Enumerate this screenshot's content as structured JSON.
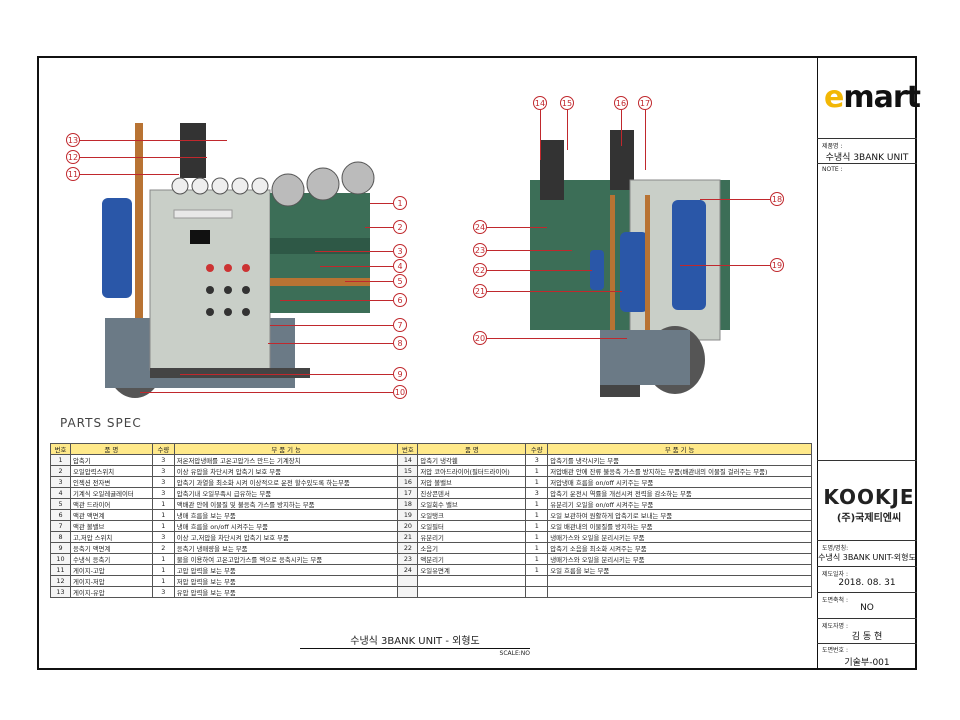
{
  "brand": {
    "logo_e": "e",
    "logo_rest": "mart"
  },
  "title_block": {
    "product_name_label": "제품명 :",
    "product_name": "수냉식 3BANK UNIT",
    "note_label": "NOTE :",
    "company_logo": "KOOKJE",
    "company_name": "(주)국제티엔씨",
    "drawing_name_label": "도명/명칭:",
    "drawing_name": "수냉식 3BANK UNIT-외형도",
    "date_label": "제도일자 :",
    "date": "2018. 08. 31",
    "scale_label": "도면축척 :",
    "scale": "NO",
    "drafter_label": "제도자명 :",
    "drafter": "김 동 현",
    "drawing_no_label": "도면번호 :",
    "drawing_no": "기술부-001"
  },
  "parts_spec_title": "PARTS SPEC",
  "table_headers": {
    "no": "번호",
    "name": "품        명",
    "qty": "수량",
    "function": "부    품    기    능"
  },
  "parts_left": [
    {
      "no": "1",
      "name": "압축기",
      "qty": "3",
      "function": "저온저압냉매를 고온고압가스 만드는 기계장치"
    },
    {
      "no": "2",
      "name": "오일압력스위치",
      "qty": "3",
      "function": "이상 유압을 차단시켜 압축기 보호 부품"
    },
    {
      "no": "3",
      "name": "인젝션 전자변",
      "qty": "3",
      "function": "압축기 과열을 최소화 시켜 이상적으로 운전 할수있도록 하는부품"
    },
    {
      "no": "4",
      "name": "기계식 오일레귤레이터",
      "qty": "3",
      "function": "압축기내 오일부족시 급유하는 부품"
    },
    {
      "no": "5",
      "name": "액관 드라이어",
      "qty": "1",
      "function": "액배관 안에 이물질 및 불응축 가스를 방지하는 부품"
    },
    {
      "no": "6",
      "name": "액관 액면계",
      "qty": "1",
      "function": "냉매 흐름을 보는 부품"
    },
    {
      "no": "7",
      "name": "액관 볼밸브",
      "qty": "1",
      "function": "냉매 흐름을 on/off 시켜주는 부품"
    },
    {
      "no": "8",
      "name": "고,저압 스위치",
      "qty": "3",
      "function": "이상 고,저압을 차단시켜 압축기 보호 부품"
    },
    {
      "no": "9",
      "name": "응축기 액면계",
      "qty": "2",
      "function": "응축기 냉매량을 보는 부품"
    },
    {
      "no": "10",
      "name": "수냉식 응축기",
      "qty": "1",
      "function": "물을 이용하여 고온고압가스를 액으로 응축시키는 부품"
    },
    {
      "no": "11",
      "name": "게이지-고압",
      "qty": "1",
      "function": "고압 압력을 보는 부품"
    },
    {
      "no": "12",
      "name": "게이지-저압",
      "qty": "1",
      "function": "저압 압력을 보는 부품"
    },
    {
      "no": "13",
      "name": "게이지-유압",
      "qty": "3",
      "function": "유압 압력을 보는 부품"
    }
  ],
  "parts_right": [
    {
      "no": "14",
      "name": "압축기 냉각휀",
      "qty": "3",
      "function": "압축기를 냉각시키는 부품"
    },
    {
      "no": "15",
      "name": "저압 코아드라이어(필터드라이어)",
      "qty": "1",
      "function": "저압배관 안에 잔류 불응축 가스를 방지하는 부품(배관내의 이물질 걸러주는 부품)"
    },
    {
      "no": "16",
      "name": "저압 볼밸브",
      "qty": "1",
      "function": "저압냉매 흐름을 on/off 시키주는 부품"
    },
    {
      "no": "17",
      "name": "진상콘덴서",
      "qty": "3",
      "function": "압축기 운전시 역률을 개선시켜 전력을 감소하는 부품"
    },
    {
      "no": "18",
      "name": "오일회수 밸브",
      "qty": "1",
      "function": "유분리기 오일을 on/off 시켜주는 부품"
    },
    {
      "no": "19",
      "name": "오일탱크",
      "qty": "1",
      "function": "오일 보관하여 원활하게 압축기로 보내는 부품"
    },
    {
      "no": "20",
      "name": "오일필터",
      "qty": "1",
      "function": "오일 배관내의 이물질를 방지하는 부품"
    },
    {
      "no": "21",
      "name": "유분리기",
      "qty": "1",
      "function": "냉매가스와 오일을 분리시키는 부품"
    },
    {
      "no": "22",
      "name": "소음기",
      "qty": "1",
      "function": "압축기 소음을 최소화 시켜주는 부품"
    },
    {
      "no": "23",
      "name": "액분리기",
      "qty": "1",
      "function": "냉매가스와 오일을 분리시키는 부품"
    },
    {
      "no": "24",
      "name": "오일유면계",
      "qty": "1",
      "function": "오일 흐름을 보는 부품"
    },
    {
      "no": "",
      "name": "",
      "qty": "",
      "function": ""
    },
    {
      "no": "",
      "name": "",
      "qty": "",
      "function": ""
    }
  ],
  "drawing_caption": "수냉식 3BANK UNIT - 외형도",
  "drawing_scale": "SCALE:NO",
  "callouts_left": [
    "13",
    "12",
    "11",
    "1",
    "2",
    "3",
    "4",
    "5",
    "6",
    "7",
    "8",
    "9",
    "10"
  ],
  "callouts_right": [
    "14",
    "15",
    "16",
    "17",
    "18",
    "19",
    "24",
    "23",
    "22",
    "21",
    "20"
  ],
  "colors": {
    "callout": "#c0282d",
    "header_bg": "#ffe98a",
    "brand_yellow": "#f2b705"
  }
}
